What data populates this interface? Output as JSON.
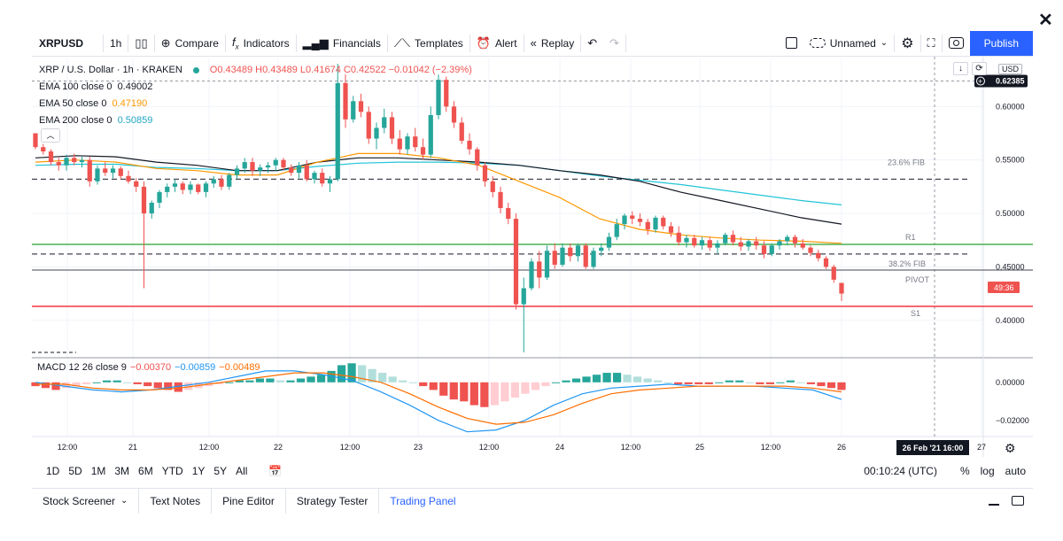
{
  "window": {
    "close_label": "✕"
  },
  "toolbar": {
    "symbol": "XRPUSD",
    "interval": "1h",
    "compare_label": "Compare",
    "indicators_label": "Indicators",
    "financials_label": "Financials",
    "templates_label": "Templates",
    "alert_label": "Alert",
    "replay_label": "Replay",
    "layout_name": "Unnamed",
    "publish_label": "Publish"
  },
  "legend": {
    "title": "XRP / U.S. Dollar · 1h · KRAKEN",
    "ohlc": "O0.43489 H0.43489 L0.41674 C0.42522 −0.01042 (−2.39%)",
    "ema100_label": "EMA 100 close 0",
    "ema100_value": "0.49002",
    "ema50_label": "EMA 50 close 0",
    "ema50_value": "0.47190",
    "ema200_label": "EMA 200 close 0",
    "ema200_value": "0.50859",
    "macd_label": "MACD 12 26 close 9",
    "macd_hist": "−0.00370",
    "macd_line": "−0.00859",
    "macd_signal": "−0.00489"
  },
  "price_scale": {
    "currency": "USD",
    "ticks": [
      "0.60000",
      "0.55000",
      "0.50000",
      "0.45000",
      "0.40000"
    ],
    "crosshair_price": "0.62385",
    "countdown": "49:36"
  },
  "macd_scale": {
    "ticks": [
      "0.00000",
      "−0.02000"
    ]
  },
  "levels": {
    "fib236": "23.6% FIB",
    "r1": "R1",
    "fib382": "38.2% FIB",
    "pivot": "PIVOT",
    "s1": "S1"
  },
  "time_axis": {
    "ticks": [
      "12:00",
      "21",
      "12:00",
      "22",
      "12:00",
      "23",
      "12:00",
      "24",
      "12:00",
      "25",
      "12:00",
      "26",
      "27"
    ],
    "crosshair_time": "26 Feb '21   16:00"
  },
  "range_bar": {
    "ranges": [
      "1D",
      "5D",
      "1M",
      "3M",
      "6M",
      "YTD",
      "1Y",
      "5Y",
      "All"
    ],
    "clock": "00:10:24 (UTC)",
    "percent": "%",
    "log": "log",
    "auto": "auto"
  },
  "bottom_tabs": [
    "Stock Screener",
    "Text Notes",
    "Pine Editor",
    "Strategy Tester",
    "Trading Panel"
  ],
  "colors": {
    "up": "#26a69a",
    "down": "#ef5350",
    "ema100": "#131722",
    "ema50": "#ff9800",
    "ema200": "#22c4d8",
    "r1": "#4caf50",
    "s1": "#f23645",
    "accent": "#2962ff"
  },
  "chart_data": {
    "type": "candlestick",
    "price_range": [
      0.365,
      0.645
    ],
    "candles": [
      [
        0.575,
        0.572,
        0.56,
        0.562
      ],
      [
        0.562,
        0.565,
        0.555,
        0.558
      ],
      [
        0.558,
        0.56,
        0.545,
        0.548
      ],
      [
        0.548,
        0.552,
        0.54,
        0.545
      ],
      [
        0.545,
        0.555,
        0.54,
        0.552
      ],
      [
        0.552,
        0.556,
        0.545,
        0.548
      ],
      [
        0.548,
        0.553,
        0.543,
        0.55
      ],
      [
        0.55,
        0.553,
        0.525,
        0.53
      ],
      [
        0.53,
        0.545,
        0.527,
        0.542
      ],
      [
        0.542,
        0.548,
        0.535,
        0.538
      ],
      [
        0.538,
        0.545,
        0.533,
        0.542
      ],
      [
        0.542,
        0.544,
        0.532,
        0.535
      ],
      [
        0.535,
        0.54,
        0.528,
        0.53
      ],
      [
        0.53,
        0.533,
        0.52,
        0.525
      ],
      [
        0.525,
        0.53,
        0.43,
        0.5
      ],
      [
        0.5,
        0.512,
        0.495,
        0.51
      ],
      [
        0.51,
        0.522,
        0.505,
        0.52
      ],
      [
        0.52,
        0.528,
        0.515,
        0.525
      ],
      [
        0.525,
        0.532,
        0.52,
        0.528
      ],
      [
        0.528,
        0.53,
        0.518,
        0.522
      ],
      [
        0.522,
        0.53,
        0.518,
        0.527
      ],
      [
        0.527,
        0.528,
        0.518,
        0.52
      ],
      [
        0.52,
        0.53,
        0.515,
        0.528
      ],
      [
        0.528,
        0.535,
        0.524,
        0.532
      ],
      [
        0.532,
        0.536,
        0.522,
        0.525
      ],
      [
        0.525,
        0.538,
        0.522,
        0.536
      ],
      [
        0.536,
        0.545,
        0.532,
        0.542
      ],
      [
        0.542,
        0.552,
        0.538,
        0.548
      ],
      [
        0.548,
        0.552,
        0.535,
        0.54
      ],
      [
        0.54,
        0.546,
        0.535,
        0.543
      ],
      [
        0.543,
        0.548,
        0.538,
        0.545
      ],
      [
        0.545,
        0.552,
        0.54,
        0.55
      ],
      [
        0.55,
        0.552,
        0.54,
        0.543
      ],
      [
        0.543,
        0.546,
        0.535,
        0.538
      ],
      [
        0.538,
        0.548,
        0.533,
        0.545
      ],
      [
        0.545,
        0.55,
        0.53,
        0.532
      ],
      [
        0.532,
        0.54,
        0.528,
        0.538
      ],
      [
        0.538,
        0.542,
        0.525,
        0.528
      ],
      [
        0.528,
        0.535,
        0.52,
        0.532
      ],
      [
        0.532,
        0.64,
        0.53,
        0.622
      ],
      [
        0.622,
        0.63,
        0.58,
        0.588
      ],
      [
        0.588,
        0.61,
        0.585,
        0.605
      ],
      [
        0.605,
        0.612,
        0.59,
        0.595
      ],
      [
        0.595,
        0.6,
        0.565,
        0.57
      ],
      [
        0.57,
        0.585,
        0.56,
        0.58
      ],
      [
        0.58,
        0.598,
        0.575,
        0.59
      ],
      [
        0.59,
        0.595,
        0.565,
        0.57
      ],
      [
        0.57,
        0.578,
        0.555,
        0.56
      ],
      [
        0.56,
        0.575,
        0.555,
        0.572
      ],
      [
        0.572,
        0.58,
        0.558,
        0.562
      ],
      [
        0.562,
        0.57,
        0.55,
        0.555
      ],
      [
        0.555,
        0.6,
        0.552,
        0.592
      ],
      [
        0.592,
        0.63,
        0.588,
        0.625
      ],
      [
        0.625,
        0.628,
        0.595,
        0.6
      ],
      [
        0.6,
        0.605,
        0.58,
        0.585
      ],
      [
        0.585,
        0.59,
        0.565,
        0.568
      ],
      [
        0.568,
        0.575,
        0.555,
        0.56
      ],
      [
        0.56,
        0.562,
        0.54,
        0.545
      ],
      [
        0.545,
        0.548,
        0.525,
        0.53
      ],
      [
        0.53,
        0.535,
        0.515,
        0.52
      ],
      [
        0.52,
        0.525,
        0.5,
        0.505
      ],
      [
        0.505,
        0.51,
        0.49,
        0.495
      ],
      [
        0.495,
        0.5,
        0.41,
        0.415
      ],
      [
        0.415,
        0.44,
        0.37,
        0.43
      ],
      [
        0.43,
        0.458,
        0.428,
        0.455
      ],
      [
        0.455,
        0.465,
        0.43,
        0.44
      ],
      [
        0.44,
        0.47,
        0.438,
        0.465
      ],
      [
        0.465,
        0.472,
        0.448,
        0.452
      ],
      [
        0.452,
        0.472,
        0.45,
        0.468
      ],
      [
        0.468,
        0.472,
        0.455,
        0.46
      ],
      [
        0.46,
        0.472,
        0.455,
        0.47
      ],
      [
        0.47,
        0.472,
        0.448,
        0.45
      ],
      [
        0.45,
        0.468,
        0.448,
        0.465
      ],
      [
        0.465,
        0.472,
        0.46,
        0.468
      ],
      [
        0.468,
        0.482,
        0.465,
        0.478
      ],
      [
        0.478,
        0.495,
        0.475,
        0.49
      ],
      [
        0.49,
        0.5,
        0.485,
        0.498
      ],
      [
        0.498,
        0.502,
        0.49,
        0.495
      ],
      [
        0.495,
        0.5,
        0.488,
        0.492
      ],
      [
        0.492,
        0.495,
        0.48,
        0.485
      ],
      [
        0.485,
        0.498,
        0.482,
        0.496
      ],
      [
        0.496,
        0.498,
        0.485,
        0.488
      ],
      [
        0.488,
        0.492,
        0.478,
        0.482
      ],
      [
        0.482,
        0.488,
        0.47,
        0.473
      ],
      [
        0.473,
        0.48,
        0.468,
        0.477
      ],
      [
        0.477,
        0.48,
        0.468,
        0.47
      ],
      [
        0.47,
        0.478,
        0.466,
        0.475
      ],
      [
        0.475,
        0.478,
        0.465,
        0.468
      ],
      [
        0.468,
        0.475,
        0.462,
        0.472
      ],
      [
        0.472,
        0.482,
        0.47,
        0.48
      ],
      [
        0.48,
        0.484,
        0.47,
        0.473
      ],
      [
        0.473,
        0.478,
        0.465,
        0.469
      ],
      [
        0.469,
        0.476,
        0.465,
        0.474
      ],
      [
        0.474,
        0.478,
        0.466,
        0.47
      ],
      [
        0.47,
        0.474,
        0.458,
        0.462
      ],
      [
        0.462,
        0.472,
        0.46,
        0.47
      ],
      [
        0.47,
        0.476,
        0.466,
        0.474
      ],
      [
        0.474,
        0.48,
        0.47,
        0.478
      ],
      [
        0.478,
        0.48,
        0.468,
        0.472
      ],
      [
        0.472,
        0.476,
        0.466,
        0.468
      ],
      [
        0.468,
        0.47,
        0.46,
        0.463
      ],
      [
        0.463,
        0.466,
        0.455,
        0.458
      ],
      [
        0.458,
        0.46,
        0.448,
        0.45
      ],
      [
        0.45,
        0.452,
        0.435,
        0.438
      ],
      [
        0.435,
        0.435,
        0.418,
        0.425
      ]
    ],
    "ema100": [
      0.552,
      0.554,
      0.553,
      0.548,
      0.545,
      0.54,
      0.54,
      0.548,
      0.552,
      0.552,
      0.55,
      0.548,
      0.545,
      0.54,
      0.536,
      0.53,
      0.52,
      0.512,
      0.504,
      0.496,
      0.49
    ],
    "ema50": [
      0.548,
      0.55,
      0.548,
      0.542,
      0.54,
      0.536,
      0.536,
      0.548,
      0.556,
      0.556,
      0.552,
      0.545,
      0.53,
      0.515,
      0.495,
      0.485,
      0.48,
      0.477,
      0.475,
      0.474,
      0.472
    ],
    "ema200": [
      0.545,
      0.546,
      0.546,
      0.543,
      0.542,
      0.54,
      0.54,
      0.544,
      0.547,
      0.548,
      0.548,
      0.547,
      0.545,
      0.54,
      0.535,
      0.531,
      0.527,
      0.522,
      0.517,
      0.512,
      0.508
    ],
    "macd_range": [
      -0.028,
      0.012
    ],
    "macd_hist": [
      -0.002,
      -0.003,
      -0.004,
      -0.003,
      -0.002,
      -0.001,
      0.0,
      0.001,
      0.001,
      0.0,
      -0.001,
      -0.002,
      -0.003,
      -0.004,
      -0.005,
      -0.004,
      -0.003,
      -0.002,
      -0.001,
      0.0,
      0.001,
      0.001,
      0.002,
      0.002,
      0.001,
      0.001,
      0.002,
      0.003,
      0.004,
      0.006,
      0.009,
      0.01,
      0.009,
      0.007,
      0.005,
      0.003,
      0.001,
      0.0,
      -0.002,
      -0.004,
      -0.007,
      -0.009,
      -0.01,
      -0.012,
      -0.013,
      -0.012,
      -0.01,
      -0.008,
      -0.006,
      -0.004,
      -0.002,
      0.0,
      0.001,
      0.002,
      0.003,
      0.004,
      0.005,
      0.005,
      0.004,
      0.003,
      0.002,
      0.001,
      0.0,
      -0.001,
      -0.001,
      -0.001,
      -0.001,
      0.0,
      0.001,
      0.001,
      0.0,
      -0.001,
      -0.001,
      0.0,
      0.001,
      0.0,
      -0.001,
      -0.002,
      -0.003,
      -0.004
    ],
    "macd_line": [
      0.0,
      -0.002,
      -0.004,
      -0.005,
      -0.004,
      -0.002,
      0.0,
      0.003,
      0.006,
      0.006,
      0.004,
      0.001,
      -0.005,
      -0.012,
      -0.02,
      -0.026,
      -0.025,
      -0.02,
      -0.012,
      -0.006,
      -0.003,
      -0.002,
      -0.001,
      -0.002,
      -0.002,
      -0.002,
      -0.003,
      -0.004,
      -0.009
    ],
    "macd_signal": [
      -0.001,
      -0.001,
      -0.003,
      -0.004,
      -0.004,
      -0.003,
      -0.001,
      0.001,
      0.003,
      0.005,
      0.005,
      0.003,
      0.0,
      -0.006,
      -0.013,
      -0.019,
      -0.022,
      -0.021,
      -0.017,
      -0.011,
      -0.006,
      -0.004,
      -0.003,
      -0.002,
      -0.002,
      -0.002,
      -0.002,
      -0.003,
      -0.005
    ],
    "horizontal_levels": {
      "fib236": 0.532,
      "r1": 0.471,
      "fib382": 0.462,
      "pivot": 0.447,
      "s1": 0.413
    }
  }
}
